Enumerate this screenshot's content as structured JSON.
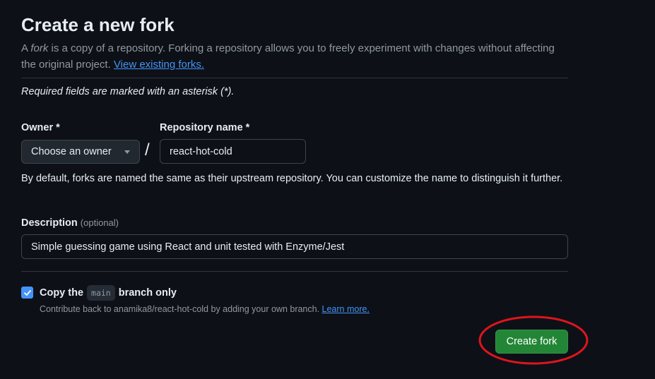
{
  "header": {
    "title": "Create a new fork",
    "intro_prefix": "A ",
    "intro_fork_word": "fork",
    "intro_rest": " is a copy of a repository. Forking a repository allows you to freely experiment with changes without affecting the original project. ",
    "view_forks_link": "View existing forks."
  },
  "form": {
    "required_note": "Required fields are marked with an asterisk (*).",
    "owner_label": "Owner *",
    "owner_value": "Choose an owner",
    "slash": "/",
    "repo_label": "Repository name *",
    "repo_value": "react-hot-cold",
    "repo_hint": "By default, forks are named the same as their upstream repository. You can customize the name to distinguish it further.",
    "description_label": "Description",
    "description_optional": "(optional)",
    "description_value": "Simple guessing game using React and unit tested with Enzyme/Jest",
    "copy_prefix": "Copy the",
    "copy_branch": "main",
    "copy_suffix": "branch only",
    "copy_checked": true,
    "contribute_text": "Contribute back to anamika8/react-hot-cold by adding your own branch. ",
    "learn_more_link": "Learn more.",
    "create_button": "Create fork"
  },
  "colors": {
    "background": "#0d1117",
    "accent_link": "#4493f8",
    "primary_button": "#238636",
    "annotation": "#e0141c"
  },
  "icons": {
    "checkbox": "check-icon",
    "select": "triangle-down-icon"
  }
}
